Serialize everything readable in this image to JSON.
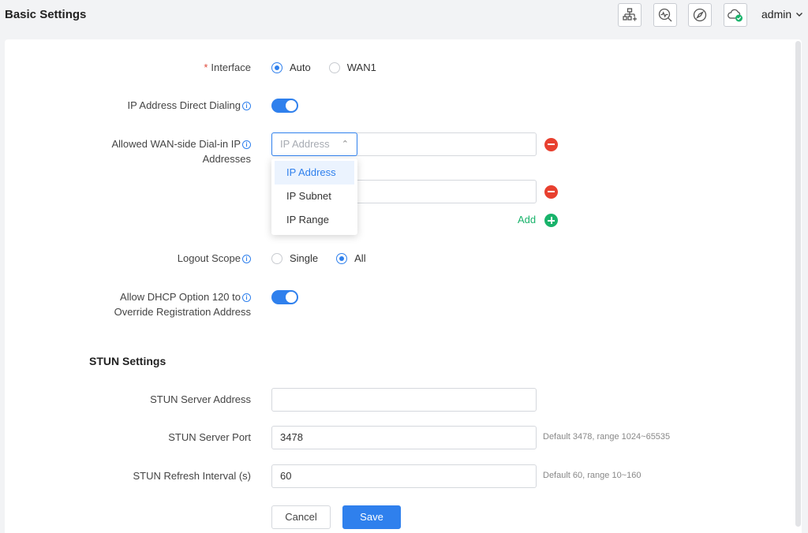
{
  "header": {
    "title": "Basic Settings",
    "user": "admin",
    "tools": [
      "network-topology-icon",
      "search-diagnose-icon",
      "compass-icon",
      "cloud-status-icon"
    ]
  },
  "form": {
    "interface": {
      "required_mark": "*",
      "label": "Interface",
      "options": [
        "Auto",
        "WAN1"
      ],
      "selected": "Auto"
    },
    "direct_dialing": {
      "label": "IP Address Direct Dialing",
      "enabled": true
    },
    "allowed_ips": {
      "label_line1": "Allowed WAN-side Dial-in IP",
      "label_line2": "Addresses",
      "type_placeholder": "IP Address",
      "type_options": [
        "IP Address",
        "IP Subnet",
        "IP Range"
      ],
      "add_label": "Add"
    },
    "logout_scope": {
      "label": "Logout Scope",
      "options": [
        "Single",
        "All"
      ],
      "selected": "All"
    },
    "dhcp_option": {
      "label_line1": "Allow DHCP Option 120 to",
      "label_line2": "Override Registration Address",
      "enabled": true
    }
  },
  "stun": {
    "title": "STUN Settings",
    "server_address": {
      "label": "STUN Server Address",
      "value": ""
    },
    "server_port": {
      "label": "STUN Server Port",
      "value": "3478",
      "hint": "Default 3478, range 1024~65535"
    },
    "refresh_interval": {
      "label": "STUN Refresh Interval (s)",
      "value": "60",
      "hint": "Default 60, range 10~160"
    }
  },
  "actions": {
    "cancel": "Cancel",
    "save": "Save"
  },
  "colors": {
    "accent": "#2f80ed",
    "danger": "#e8402f",
    "success": "#19b36b"
  }
}
